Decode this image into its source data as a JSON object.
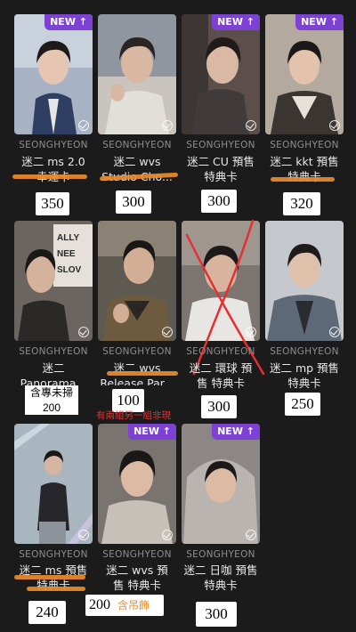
{
  "colors": {
    "background": "#1b1b1b",
    "new_badge": "#7d42d4",
    "highlight": "#e98a2c",
    "cross": "#e53030"
  },
  "new_badge_label": "NEW ↑",
  "cards": [
    {
      "artist": "SEONGHYEON",
      "title": "迷二 ms 2.0\n幸運卡",
      "price": "350",
      "new": true
    },
    {
      "artist": "SEONGHYEON",
      "title": "迷二 wvs\nStudio Cho...",
      "price": "300",
      "new": false
    },
    {
      "artist": "SEONGHYEON",
      "title": "迷二 CU 預售\n特典卡",
      "price": "300",
      "new": true
    },
    {
      "artist": "SEONGHYEON",
      "title": "迷二 kkt 預售\n特典卡",
      "price": "320",
      "new": true
    },
    {
      "artist": "SEONGHYEON",
      "title": "迷二\nPanorama...",
      "price": "200",
      "price_note": "含專未掃",
      "new": false
    },
    {
      "artist": "SEONGHYEON",
      "title": "迷二 wvs\nRelease Par...",
      "price": "100",
      "new": false
    },
    {
      "artist": "SEONGHYEON",
      "title": "迷二 環球 預\n售 特典卡",
      "price": "300",
      "new": false,
      "crossed": true
    },
    {
      "artist": "SEONGHYEON",
      "title": "迷二 mp 預售\n特典卡",
      "price": "250",
      "new": false
    },
    {
      "artist": "SEONGHYEON",
      "title": "迷二 ms 預售\n特典卡",
      "price": "240",
      "new": false
    },
    {
      "artist": "SEONGHYEON",
      "title": "迷二 wvs 預\n售 特典卡",
      "price": "200",
      "price_note": "含吊飾",
      "new": true
    },
    {
      "artist": "SEONGHYEON",
      "title": "迷二 日咖 預售\n特典卡",
      "price": "300",
      "new": true
    }
  ],
  "red_note": "有兩組另一組非現"
}
